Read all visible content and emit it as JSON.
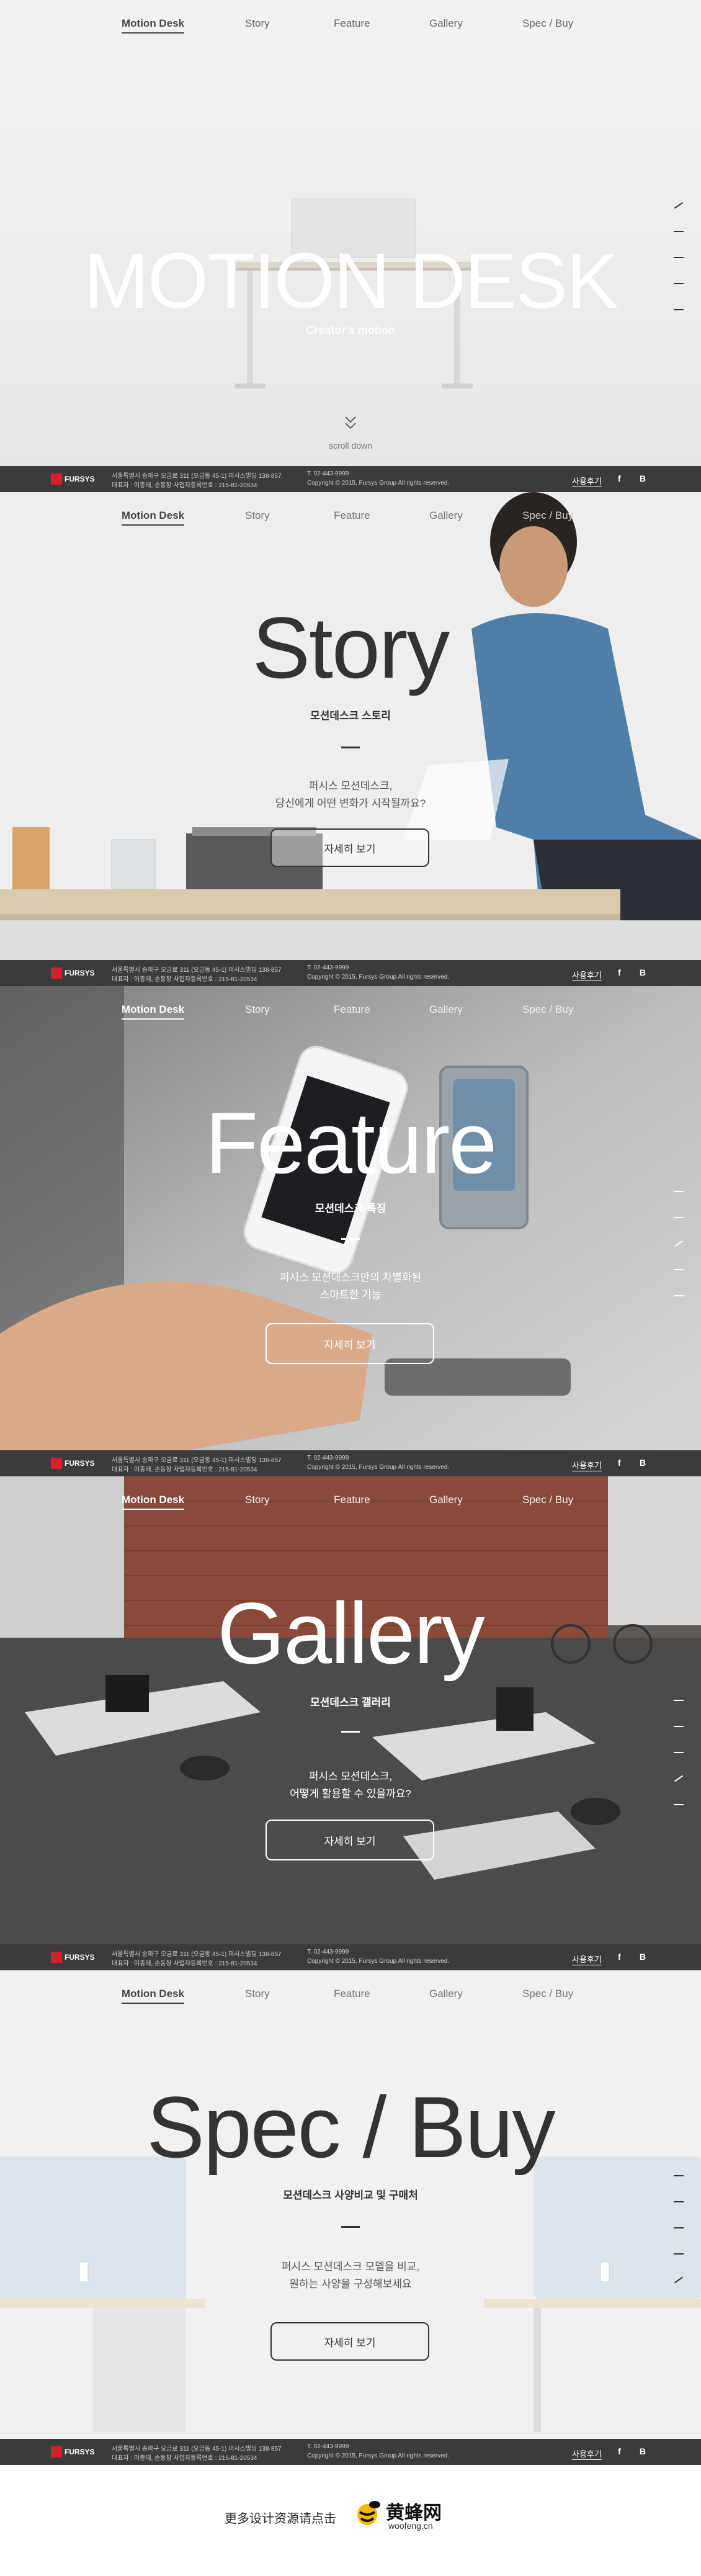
{
  "nav": {
    "items": [
      "Motion Desk",
      "Story",
      "Feature",
      "Gallery",
      "Spec / Buy"
    ]
  },
  "hero": {
    "title": "MOTION DESK",
    "subtitle": "Creator's motion",
    "scroll_label": "scroll down"
  },
  "story": {
    "title": "Story",
    "subtitle": "모션데스크 스토리",
    "desc": [
      "퍼시스 모션데스크,",
      "당신에게 어떤 변화가 시작될까요?"
    ],
    "button": "자세히 보기"
  },
  "feature": {
    "title": "Feature",
    "subtitle": "모션데스크 특징",
    "desc": [
      "퍼시스 모션데스크만의 차별화된",
      "스마트한 기능"
    ],
    "button": "자세히 보기"
  },
  "gallery": {
    "title": "Gallery",
    "subtitle": "모션데스크 갤러리",
    "desc": [
      "퍼시스 모션데스크,",
      "어떻게 활용할 수 있을까요?"
    ],
    "button": "자세히 보기"
  },
  "spec": {
    "title": "Spec / Buy",
    "subtitle": "모션데스크 사양비교 및 구매처",
    "desc": [
      "퍼시스 모션데스크 모델을 비교,",
      "원하는 사양을 구성해보세요"
    ],
    "button": "자세히 보기"
  },
  "footer": {
    "logo": "FURSYS",
    "address": "서울특별시 송파구 오금로 311 (오금동 45-1) 퍼시스빌딩  138-857",
    "ceo": "대표자 : 이종태, 손동창          사업자등록번호 : 215-81-20534",
    "tel": "T. 02-443-9999",
    "copyright": "Copyright © 2015, Fursys Group All rights reserved.",
    "review": "사용후기",
    "facebook": "f",
    "blog": "B"
  },
  "bottom": {
    "text": "更多设计资源请点击",
    "brand_cn": "黄蜂网",
    "brand_en": "woofeng.cn"
  }
}
